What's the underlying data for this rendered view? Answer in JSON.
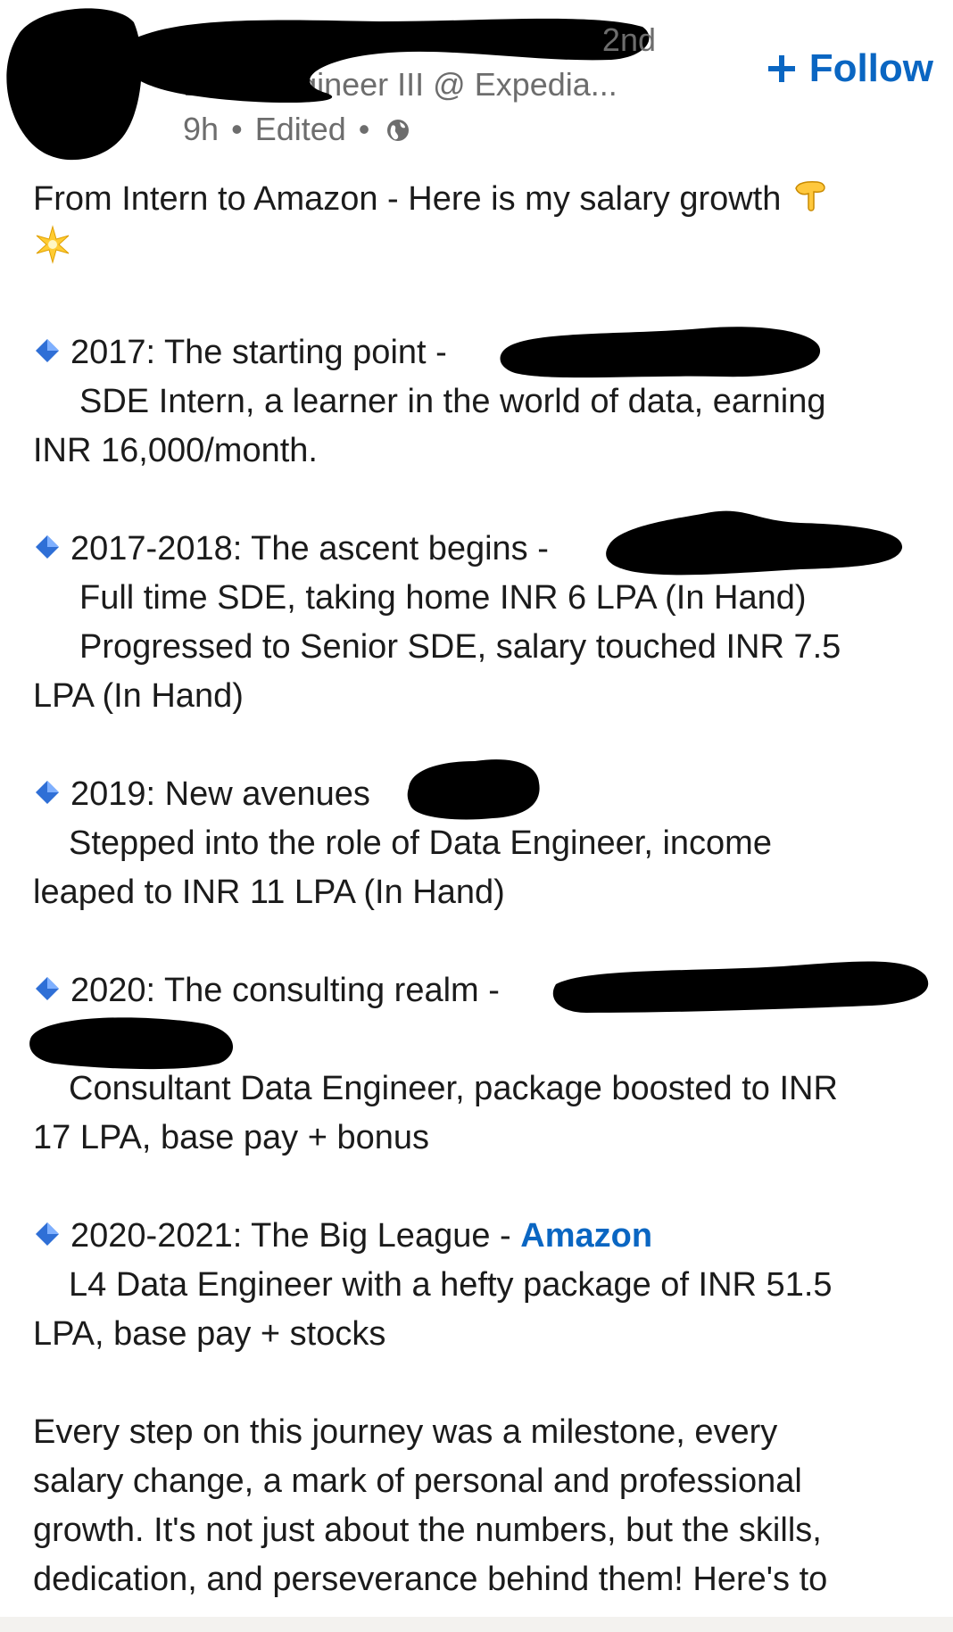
{
  "author": {
    "connection_degree": "2nd",
    "headline": "Data Engineer III @ Expedia...",
    "time": "9h",
    "edited": "Edited",
    "separator": "•"
  },
  "follow_button": {
    "label": "Follow"
  },
  "post": {
    "intro": "From Intern to Amazon - Here is my salary growth",
    "milestones": [
      {
        "title": "2017: The starting point -",
        "lines": [
          "SDE Intern, a learner in the world of data, earning",
          "INR 16,000/month."
        ]
      },
      {
        "title": "2017-2018: The ascent begins -",
        "lines": [
          "Full time SDE, taking home INR 6 LPA (In Hand)",
          "Progressed to Senior SDE, salary touched INR 7.5",
          "LPA (In Hand)"
        ]
      },
      {
        "title": "2019: New avenues",
        "lines": [
          "Stepped into the role of Data Engineer, income",
          "leaped to INR 11 LPA (In Hand)"
        ]
      },
      {
        "title": "2020: The consulting realm -",
        "lines": [
          "Consultant Data Engineer, package boosted to INR",
          "17 LPA, base pay + bonus"
        ]
      },
      {
        "title": "2020-2021: The Big League - ",
        "company": "Amazon",
        "lines": [
          "L4 Data Engineer with a hefty package of INR 51.5",
          "LPA, base pay + stocks"
        ]
      }
    ],
    "closing": [
      "Every step on this journey was a milestone, every",
      "salary change, a mark of personal and professional",
      "growth. It's not just about the numbers, but the skills,",
      "dedication, and perseverance behind them! Here's to"
    ]
  },
  "icons": {
    "globe": "globe-icon",
    "plus": "plus-icon",
    "pointing_down": "pointing-down-emoji-icon",
    "sparkle": "sparkle-emoji-icon",
    "diamond": "blue-diamond-icon"
  },
  "colors": {
    "link": "#0a66c2",
    "meta": "#6d6d6d",
    "text": "#1b1b1b",
    "redaction": "#000000",
    "diamond": "#2f6fd6"
  }
}
